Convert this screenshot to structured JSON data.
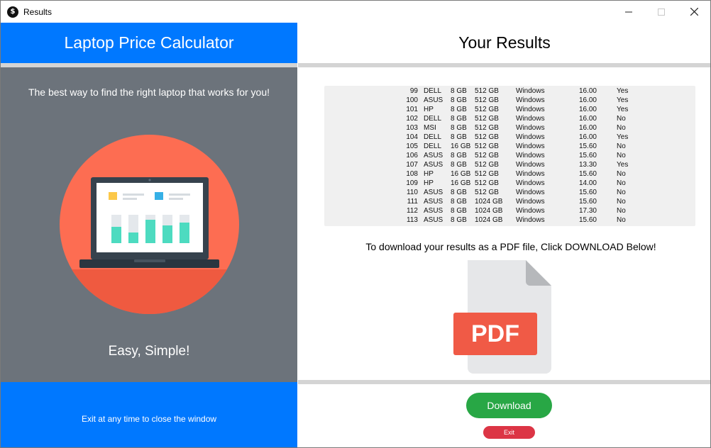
{
  "window": {
    "title": "Results",
    "app_icon": "dollar-icon",
    "controls": {
      "minimize": "—",
      "maximize": "☐",
      "close": "✕"
    }
  },
  "left": {
    "header": "Laptop Price Calculator",
    "tagline": "The best way to find the right laptop that works for you!",
    "slogan": "Easy, Simple!",
    "exit_note": "Exit at any time to close the window",
    "header_color": "#0078ff",
    "panel_color": "#6c737b"
  },
  "right": {
    "header": "Your Results",
    "results": [
      {
        "id": "99",
        "brand": "DELL",
        "ram": "8 GB",
        "ssd": "512 GB",
        "os": "Windows",
        "screen": "16.00",
        "touch": "Yes"
      },
      {
        "id": "100",
        "brand": "ASUS",
        "ram": "8 GB",
        "ssd": "512 GB",
        "os": "Windows",
        "screen": "16.00",
        "touch": "Yes"
      },
      {
        "id": "101",
        "brand": "HP",
        "ram": "8 GB",
        "ssd": "512 GB",
        "os": "Windows",
        "screen": "16.00",
        "touch": "Yes"
      },
      {
        "id": "102",
        "brand": "DELL",
        "ram": "8 GB",
        "ssd": "512 GB",
        "os": "Windows",
        "screen": "16.00",
        "touch": "No"
      },
      {
        "id": "103",
        "brand": "MSI",
        "ram": "8 GB",
        "ssd": "512 GB",
        "os": "Windows",
        "screen": "16.00",
        "touch": "No"
      },
      {
        "id": "104",
        "brand": "DELL",
        "ram": "8 GB",
        "ssd": "512 GB",
        "os": "Windows",
        "screen": "16.00",
        "touch": "Yes"
      },
      {
        "id": "105",
        "brand": "DELL",
        "ram": "16 GB",
        "ssd": "512 GB",
        "os": "Windows",
        "screen": "15.60",
        "touch": "No"
      },
      {
        "id": "106",
        "brand": "ASUS",
        "ram": "8 GB",
        "ssd": "512 GB",
        "os": "Windows",
        "screen": "15.60",
        "touch": "No"
      },
      {
        "id": "107",
        "brand": "ASUS",
        "ram": "8 GB",
        "ssd": "512 GB",
        "os": "Windows",
        "screen": "13.30",
        "touch": "Yes"
      },
      {
        "id": "108",
        "brand": "HP",
        "ram": "16 GB",
        "ssd": "512 GB",
        "os": "Windows",
        "screen": "15.60",
        "touch": "No"
      },
      {
        "id": "109",
        "brand": "HP",
        "ram": "16 GB",
        "ssd": "512 GB",
        "os": "Windows",
        "screen": "14.00",
        "touch": "No"
      },
      {
        "id": "110",
        "brand": "ASUS",
        "ram": "8 GB",
        "ssd": "512 GB",
        "os": "Windows",
        "screen": "15.60",
        "touch": "No"
      },
      {
        "id": "111",
        "brand": "ASUS",
        "ram": "8 GB",
        "ssd": "1024 GB",
        "os": "Windows",
        "screen": "15.60",
        "touch": "No"
      },
      {
        "id": "112",
        "brand": "ASUS",
        "ram": "8 GB",
        "ssd": "1024 GB",
        "os": "Windows",
        "screen": "17.30",
        "touch": "No"
      },
      {
        "id": "113",
        "brand": "ASUS",
        "ram": "8 GB",
        "ssd": "1024 GB",
        "os": "Windows",
        "screen": "15.60",
        "touch": "No"
      }
    ],
    "download_message": "To download your results as a PDF file, Click DOWNLOAD Below!",
    "pdf_icon": "pdf-file-icon",
    "pdf_label": "PDF",
    "download_label": "Download",
    "exit_label": "Exit",
    "download_color": "#28a745",
    "exit_color": "#dc3545"
  }
}
